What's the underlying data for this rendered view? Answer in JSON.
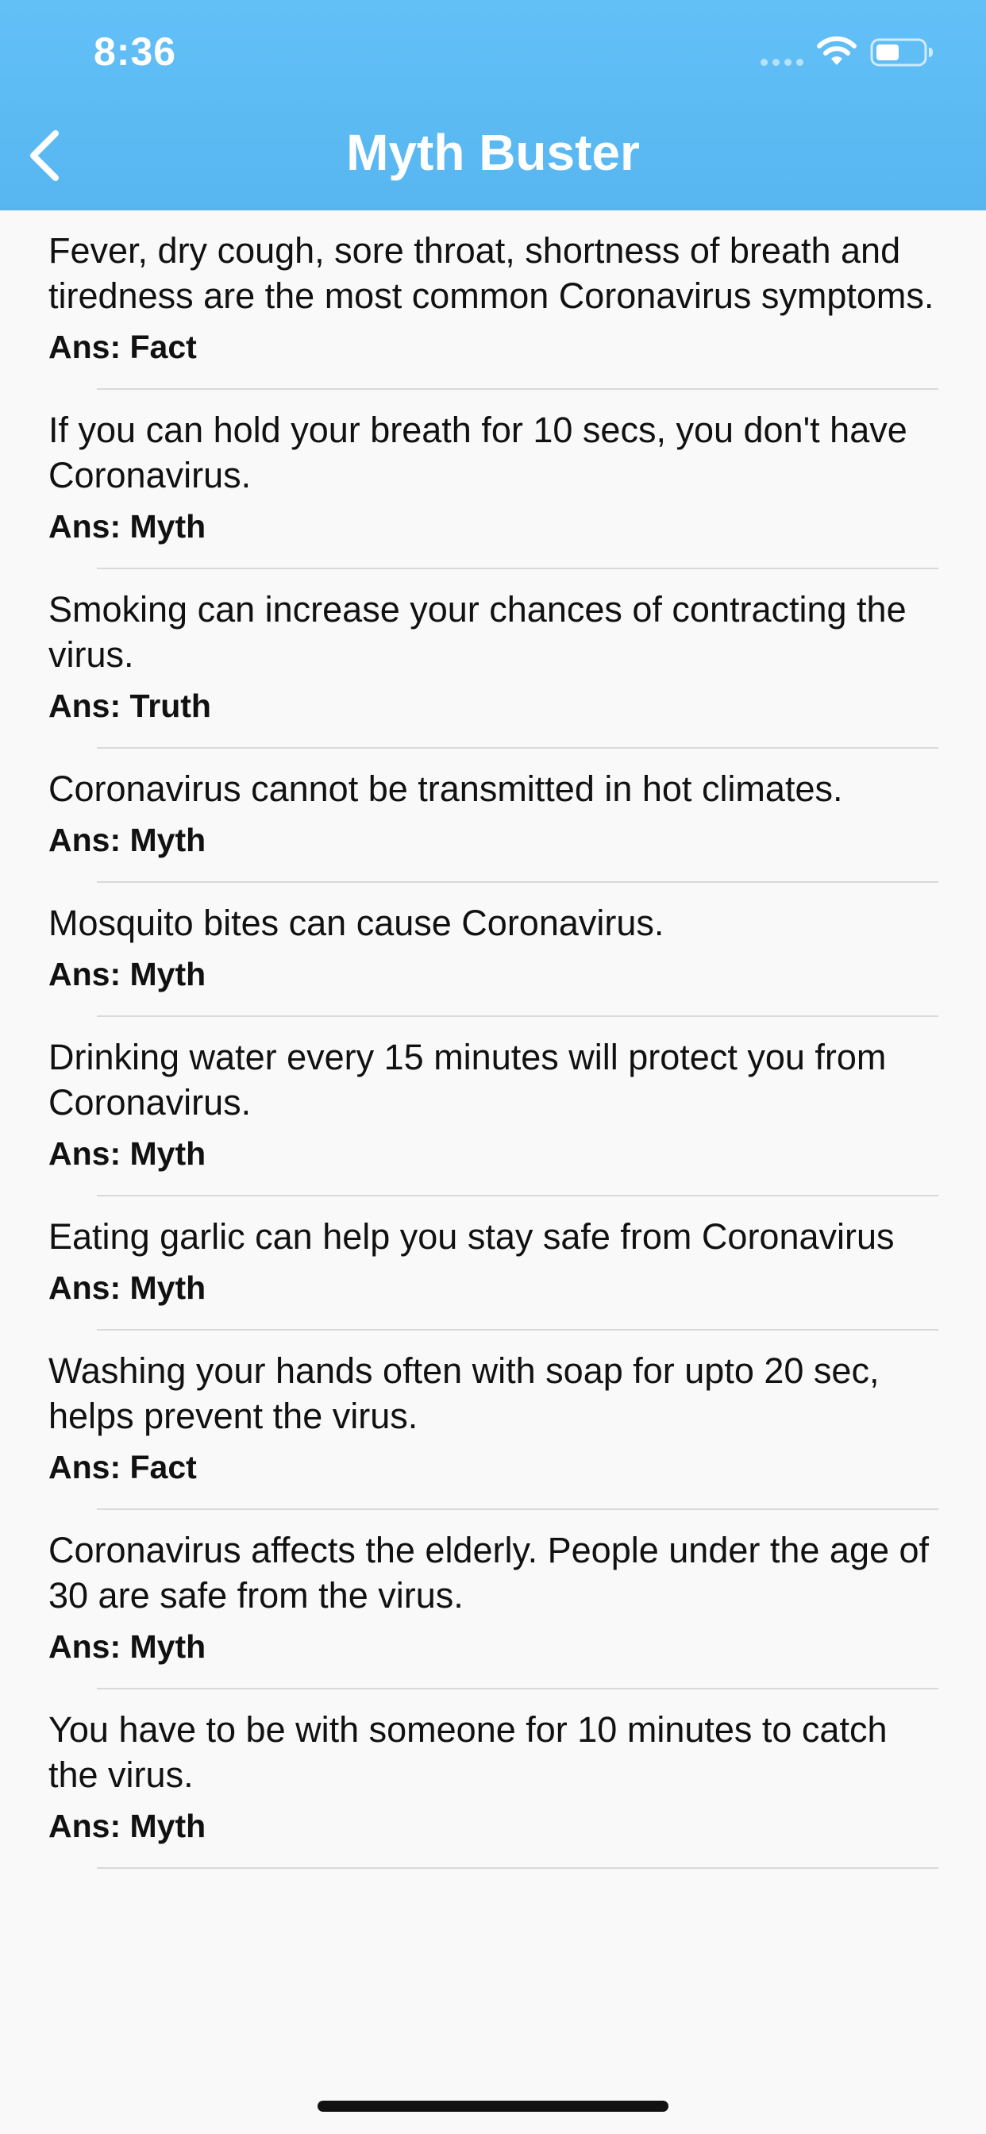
{
  "status_bar": {
    "time": "8:36",
    "icons": [
      "signal-icon",
      "wifi-icon",
      "battery-icon"
    ]
  },
  "nav": {
    "title": "Myth Buster",
    "back_icon": "chevron-left-icon"
  },
  "colors": {
    "header": "#5ab8f2",
    "background": "#f9f9f9",
    "divider": "#d9d9d9",
    "text": "#111111"
  },
  "items": [
    {
      "text": "Fever, dry cough, sore throat, shortness of breath and tiredness are the most common Coronavirus symptoms.",
      "answer": "Ans: Fact"
    },
    {
      "text": "If you can hold your breath for 10 secs, you don't have Coronavirus.",
      "answer": "Ans: Myth"
    },
    {
      "text": "Smoking can increase your chances of contracting the virus.",
      "answer": "Ans: Truth"
    },
    {
      "text": "Coronavirus cannot be transmitted in hot climates.",
      "answer": "Ans: Myth"
    },
    {
      "text": "Mosquito bites can cause Coronavirus.",
      "answer": "Ans: Myth"
    },
    {
      "text": "Drinking water every 15 minutes will protect you from Coronavirus.",
      "answer": "Ans: Myth"
    },
    {
      "text": "Eating garlic can help you stay safe from Coronavirus",
      "answer": "Ans: Myth"
    },
    {
      "text": "Washing your hands often with soap for upto 20 sec, helps prevent the virus.",
      "answer": "Ans: Fact"
    },
    {
      "text": "Coronavirus affects the elderly. People under the age of 30 are safe from the virus.",
      "answer": "Ans: Myth"
    },
    {
      "text": "You have to be with someone for 10 minutes to catch the virus.",
      "answer": "Ans: Myth"
    }
  ]
}
